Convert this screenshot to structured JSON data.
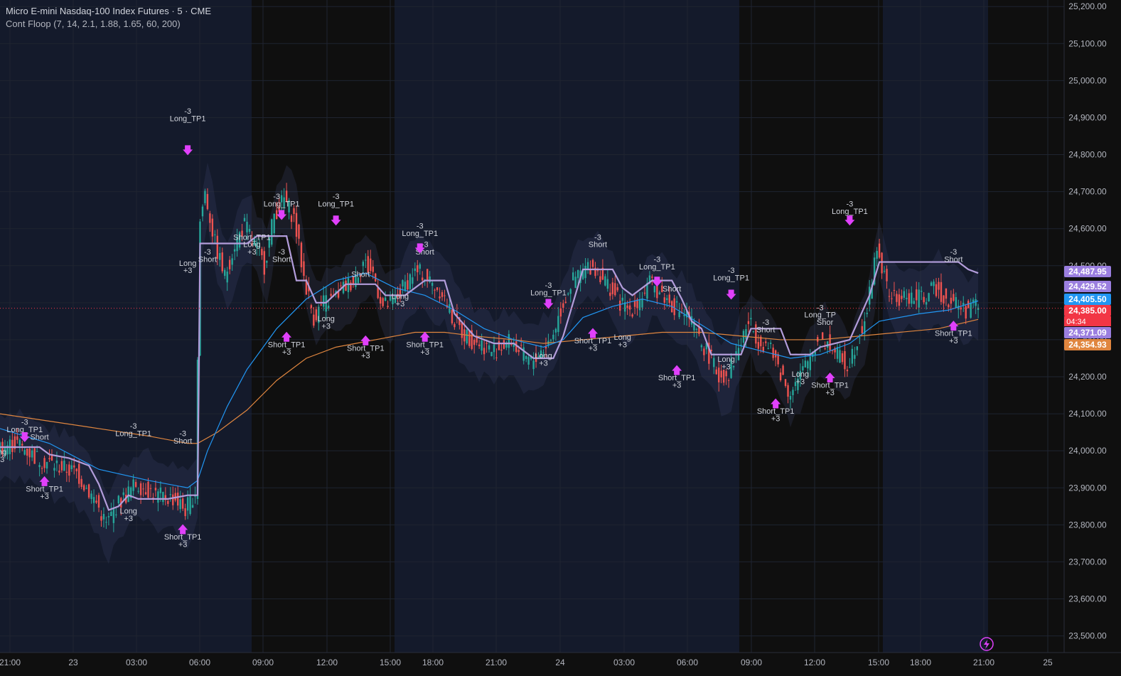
{
  "header": {
    "title": "Micro E-mini Nasdaq-100 Index Futures · 5 · CME",
    "indicator": "Cont Floop (7, 14, 2.1, 1.88, 1.65, 60, 200)"
  },
  "colors": {
    "background": "#0f0f0f",
    "session_bg": "#141a2b",
    "grid": "#1f2430",
    "text": "#d1d4dc",
    "up": "#26a69a",
    "down": "#ef5350",
    "stop_line": "#b39ddb",
    "ema_fast": "#2196f3",
    "ema_slow": "#e0863f",
    "signal_magenta": "#e040fb",
    "signal_red": "#f23645",
    "signal_blue": "#2962ff"
  },
  "chart_data": {
    "type": "candlestick",
    "symbol": "MNQ",
    "timeframe": "5",
    "ylim": [
      23480,
      25210
    ],
    "y_ticks": [
      "25,200.00",
      "25,100.00",
      "25,000.00",
      "24,900.00",
      "24,800.00",
      "24,700.00",
      "24,600.00",
      "24,500.00",
      "24,400.00",
      "24,300.00",
      "24,200.00",
      "24,100.00",
      "24,000.00",
      "23,900.00",
      "23,800.00",
      "23,700.00",
      "23,600.00",
      "23,500.00"
    ],
    "x_ticks": [
      "21:00",
      "23",
      "03:00",
      "06:00",
      "09:00",
      "12:00",
      "15:00",
      "18:00",
      "21:00",
      "24",
      "03:00",
      "06:00",
      "09:00",
      "12:00",
      "15:00",
      "18:00",
      "21:00",
      "25"
    ],
    "last_price": 24385.0,
    "countdown": "04:34",
    "price_labels": [
      {
        "value": "24,487.95",
        "color": "#9b7fe0"
      },
      {
        "value": "24,429.52",
        "color": "#9b7fe0"
      },
      {
        "value": "24,405.50",
        "color": "#2196f3"
      },
      {
        "value": "24,385.00",
        "color": "#f23645"
      },
      {
        "value": "24,371.09",
        "color": "#9b7fe0"
      },
      {
        "value": "24,354.93",
        "color": "#e0863f"
      }
    ],
    "price_path": [
      [
        0,
        24010
      ],
      [
        4,
        24020
      ],
      [
        8,
        23980
      ],
      [
        12,
        23960
      ],
      [
        16,
        23940
      ],
      [
        20,
        23860
      ],
      [
        22,
        23800
      ],
      [
        24,
        23850
      ],
      [
        26,
        23880
      ],
      [
        28,
        23910
      ],
      [
        30,
        23900
      ],
      [
        32,
        23880
      ],
      [
        36,
        23870
      ],
      [
        38,
        23840
      ],
      [
        40,
        23890
      ],
      [
        41,
        24620
      ],
      [
        42,
        24700
      ],
      [
        44,
        24560
      ],
      [
        46,
        24470
      ],
      [
        48,
        24560
      ],
      [
        50,
        24610
      ],
      [
        52,
        24560
      ],
      [
        54,
        24500
      ],
      [
        56,
        24640
      ],
      [
        58,
        24680
      ],
      [
        60,
        24630
      ],
      [
        62,
        24470
      ],
      [
        64,
        24360
      ],
      [
        66,
        24400
      ],
      [
        68,
        24410
      ],
      [
        70,
        24440
      ],
      [
        72,
        24460
      ],
      [
        74,
        24510
      ],
      [
        76,
        24480
      ],
      [
        78,
        24390
      ],
      [
        80,
        24400
      ],
      [
        82,
        24440
      ],
      [
        84,
        24480
      ],
      [
        86,
        24480
      ],
      [
        88,
        24450
      ],
      [
        90,
        24430
      ],
      [
        92,
        24360
      ],
      [
        94,
        24320
      ],
      [
        96,
        24300
      ],
      [
        98,
        24290
      ],
      [
        100,
        24270
      ],
      [
        102,
        24280
      ],
      [
        104,
        24300
      ],
      [
        106,
        24260
      ],
      [
        108,
        24240
      ],
      [
        110,
        24270
      ],
      [
        112,
        24300
      ],
      [
        114,
        24380
      ],
      [
        116,
        24450
      ],
      [
        118,
        24480
      ],
      [
        120,
        24500
      ],
      [
        122,
        24480
      ],
      [
        124,
        24440
      ],
      [
        126,
        24400
      ],
      [
        128,
        24380
      ],
      [
        130,
        24410
      ],
      [
        132,
        24450
      ],
      [
        134,
        24430
      ],
      [
        136,
        24400
      ],
      [
        138,
        24380
      ],
      [
        140,
        24360
      ],
      [
        142,
        24300
      ],
      [
        144,
        24260
      ],
      [
        146,
        24200
      ],
      [
        148,
        24210
      ],
      [
        150,
        24280
      ],
      [
        152,
        24350
      ],
      [
        154,
        24300
      ],
      [
        156,
        24280
      ],
      [
        158,
        24230
      ],
      [
        160,
        24160
      ],
      [
        162,
        24190
      ],
      [
        164,
        24240
      ],
      [
        166,
        24300
      ],
      [
        168,
        24290
      ],
      [
        170,
        24260
      ],
      [
        172,
        24230
      ],
      [
        174,
        24300
      ],
      [
        176,
        24380
      ],
      [
        178,
        24550
      ],
      [
        180,
        24440
      ],
      [
        182,
        24400
      ],
      [
        184,
        24420
      ],
      [
        186,
        24410
      ],
      [
        188,
        24420
      ],
      [
        190,
        24440
      ],
      [
        192,
        24410
      ],
      [
        194,
        24400
      ],
      [
        196,
        24380
      ],
      [
        198,
        24395
      ]
    ],
    "stop_line": [
      [
        0,
        24010
      ],
      [
        8,
        24010
      ],
      [
        10,
        23990
      ],
      [
        14,
        23980
      ],
      [
        18,
        23960
      ],
      [
        20,
        23910
      ],
      [
        22,
        23840
      ],
      [
        24,
        23850
      ],
      [
        26,
        23880
      ],
      [
        28,
        23870
      ],
      [
        34,
        23870
      ],
      [
        38,
        23880
      ],
      [
        40,
        23880
      ],
      [
        40.5,
        24560
      ],
      [
        50,
        24560
      ],
      [
        52,
        24580
      ],
      [
        58,
        24580
      ],
      [
        60,
        24460
      ],
      [
        62,
        24460
      ],
      [
        64,
        24400
      ],
      [
        66,
        24400
      ],
      [
        70,
        24450
      ],
      [
        76,
        24450
      ],
      [
        78,
        24420
      ],
      [
        82,
        24420
      ],
      [
        86,
        24460
      ],
      [
        90,
        24460
      ],
      [
        92,
        24370
      ],
      [
        96,
        24310
      ],
      [
        100,
        24290
      ],
      [
        104,
        24290
      ],
      [
        108,
        24250
      ],
      [
        112,
        24250
      ],
      [
        114,
        24310
      ],
      [
        116,
        24400
      ],
      [
        118,
        24490
      ],
      [
        124,
        24490
      ],
      [
        126,
        24440
      ],
      [
        128,
        24420
      ],
      [
        132,
        24460
      ],
      [
        136,
        24460
      ],
      [
        138,
        24410
      ],
      [
        140,
        24350
      ],
      [
        142,
        24330
      ],
      [
        144,
        24260
      ],
      [
        150,
        24260
      ],
      [
        152,
        24330
      ],
      [
        158,
        24330
      ],
      [
        160,
        24260
      ],
      [
        164,
        24260
      ],
      [
        166,
        24280
      ],
      [
        172,
        24300
      ],
      [
        174,
        24360
      ],
      [
        176,
        24420
      ],
      [
        178,
        24510
      ],
      [
        186,
        24510
      ],
      [
        190,
        24510
      ],
      [
        194,
        24510
      ],
      [
        196,
        24490
      ],
      [
        198,
        24480
      ]
    ],
    "ema_fast": [
      [
        0,
        24060
      ],
      [
        10,
        24020
      ],
      [
        20,
        23950
      ],
      [
        30,
        23920
      ],
      [
        38,
        23900
      ],
      [
        40,
        23920
      ],
      [
        42,
        24000
      ],
      [
        46,
        24120
      ],
      [
        50,
        24220
      ],
      [
        56,
        24330
      ],
      [
        62,
        24410
      ],
      [
        68,
        24460
      ],
      [
        74,
        24480
      ],
      [
        80,
        24440
      ],
      [
        86,
        24420
      ],
      [
        92,
        24380
      ],
      [
        98,
        24330
      ],
      [
        104,
        24300
      ],
      [
        110,
        24280
      ],
      [
        114,
        24300
      ],
      [
        118,
        24360
      ],
      [
        124,
        24390
      ],
      [
        130,
        24410
      ],
      [
        136,
        24390
      ],
      [
        142,
        24340
      ],
      [
        148,
        24290
      ],
      [
        154,
        24270
      ],
      [
        160,
        24250
      ],
      [
        166,
        24260
      ],
      [
        172,
        24290
      ],
      [
        178,
        24350
      ],
      [
        186,
        24370
      ],
      [
        192,
        24380
      ],
      [
        198,
        24405
      ]
    ],
    "ema_slow": [
      [
        0,
        24100
      ],
      [
        10,
        24080
      ],
      [
        20,
        24060
      ],
      [
        30,
        24040
      ],
      [
        38,
        24020
      ],
      [
        40,
        24020
      ],
      [
        44,
        24050
      ],
      [
        50,
        24110
      ],
      [
        56,
        24190
      ],
      [
        62,
        24250
      ],
      [
        68,
        24280
      ],
      [
        76,
        24300
      ],
      [
        84,
        24320
      ],
      [
        90,
        24320
      ],
      [
        96,
        24310
      ],
      [
        104,
        24300
      ],
      [
        110,
        24290
      ],
      [
        118,
        24300
      ],
      [
        126,
        24310
      ],
      [
        134,
        24320
      ],
      [
        142,
        24320
      ],
      [
        150,
        24310
      ],
      [
        158,
        24300
      ],
      [
        166,
        24300
      ],
      [
        174,
        24310
      ],
      [
        182,
        24320
      ],
      [
        190,
        24330
      ],
      [
        198,
        24355
      ]
    ],
    "signals": [
      {
        "label": "-3",
        "type": "top",
        "x": 5,
        "y": 24070
      },
      {
        "label": "Long_TP1",
        "type": "top",
        "x": 5,
        "y": 24050
      },
      {
        "label": "Short",
        "type": "top",
        "x": 8,
        "y": 24030
      },
      {
        "label": "ong",
        "type": "bottom",
        "x": 0,
        "y": 23990
      },
      {
        "label": "+3",
        "type": "bottom",
        "x": 0,
        "y": 23970
      },
      {
        "label": "Short_TP1",
        "type": "bottom",
        "x": 9,
        "y": 23890
      },
      {
        "label": "+3",
        "type": "bottom",
        "x": 9,
        "y": 23870
      },
      {
        "label": "-3",
        "type": "top",
        "x": 27,
        "y": 24060
      },
      {
        "label": "Long_TP1",
        "type": "top",
        "x": 27,
        "y": 24040
      },
      {
        "label": "Long",
        "type": "bottom",
        "x": 26,
        "y": 23830
      },
      {
        "label": "+3",
        "type": "bottom",
        "x": 26,
        "y": 23810
      },
      {
        "label": "-3",
        "type": "top",
        "x": 37,
        "y": 24040
      },
      {
        "label": "Short",
        "type": "top",
        "x": 37,
        "y": 24020
      },
      {
        "label": "Short_TP1",
        "type": "bottom",
        "x": 37,
        "y": 23760
      },
      {
        "label": "+3",
        "type": "bottom",
        "x": 37,
        "y": 23740
      },
      {
        "label": "-3",
        "type": "top",
        "x": 38,
        "y": 24910
      },
      {
        "label": "Long_TP1",
        "type": "top",
        "x": 38,
        "y": 24890
      },
      {
        "label": "Long",
        "type": "bottom",
        "x": 38,
        "y": 24500
      },
      {
        "label": "+3",
        "type": "bottom",
        "x": 38,
        "y": 24480
      },
      {
        "label": "-3",
        "type": "top",
        "x": 42,
        "y": 24530
      },
      {
        "label": "Short",
        "type": "top",
        "x": 42,
        "y": 24510
      },
      {
        "label": "Short_TP1",
        "type": "top",
        "x": 51,
        "y": 24570
      },
      {
        "label": "Long",
        "type": "top",
        "x": 51,
        "y": 24550
      },
      {
        "label": "+3",
        "type": "top",
        "x": 51,
        "y": 24530
      },
      {
        "label": "-3",
        "type": "top",
        "x": 56,
        "y": 24680
      },
      {
        "label": "Long_TP1",
        "type": "top",
        "x": 57,
        "y": 24660
      },
      {
        "label": "-3",
        "type": "top",
        "x": 57,
        "y": 24530
      },
      {
        "label": "Short",
        "type": "top",
        "x": 57,
        "y": 24510
      },
      {
        "label": "Short_TP1",
        "type": "bottom",
        "x": 58,
        "y": 24280
      },
      {
        "label": "+3",
        "type": "bottom",
        "x": 58,
        "y": 24260
      },
      {
        "label": "-3",
        "type": "top",
        "x": 68,
        "y": 24680
      },
      {
        "label": "Long_TP1",
        "type": "top",
        "x": 68,
        "y": 24660
      },
      {
        "label": "Short",
        "type": "top",
        "x": 73,
        "y": 24470
      },
      {
        "label": "Long",
        "type": "bottom",
        "x": 66,
        "y": 24350
      },
      {
        "label": "+3",
        "type": "bottom",
        "x": 66,
        "y": 24330
      },
      {
        "label": "Short_TP1",
        "type": "bottom",
        "x": 74,
        "y": 24270
      },
      {
        "label": "+3",
        "type": "bottom",
        "x": 74,
        "y": 24250
      },
      {
        "label": "-3",
        "type": "top",
        "x": 85,
        "y": 24600
      },
      {
        "label": "Long_TP1",
        "type": "top",
        "x": 85,
        "y": 24580
      },
      {
        "label": "-3",
        "type": "top",
        "x": 86,
        "y": 24550
      },
      {
        "label": "Short",
        "type": "top",
        "x": 86,
        "y": 24530
      },
      {
        "label": "Long",
        "type": "bottom",
        "x": 81,
        "y": 24410
      },
      {
        "label": "+3",
        "type": "bottom",
        "x": 81,
        "y": 24390
      },
      {
        "label": "Short_TP1",
        "type": "bottom",
        "x": 86,
        "y": 24280
      },
      {
        "label": "+3",
        "type": "bottom",
        "x": 86,
        "y": 24260
      },
      {
        "label": "-3",
        "type": "top",
        "x": 111,
        "y": 24440
      },
      {
        "label": "Long_TP1",
        "type": "top",
        "x": 111,
        "y": 24420
      },
      {
        "label": "Long",
        "type": "bottom",
        "x": 110,
        "y": 24250
      },
      {
        "label": "+3",
        "type": "bottom",
        "x": 110,
        "y": 24230
      },
      {
        "label": "-3",
        "type": "top",
        "x": 121,
        "y": 24570
      },
      {
        "label": "Short",
        "type": "top",
        "x": 121,
        "y": 24550
      },
      {
        "label": "Short_TP1",
        "type": "bottom",
        "x": 120,
        "y": 24290
      },
      {
        "label": "+3",
        "type": "bottom",
        "x": 120,
        "y": 24270
      },
      {
        "label": "Long",
        "type": "bottom",
        "x": 126,
        "y": 24300
      },
      {
        "label": "+3",
        "type": "bottom",
        "x": 126,
        "y": 24280
      },
      {
        "label": "-3",
        "type": "top",
        "x": 133,
        "y": 24510
      },
      {
        "label": "Long_TP1",
        "type": "top",
        "x": 133,
        "y": 24490
      },
      {
        "label": "Short",
        "type": "top",
        "x": 136,
        "y": 24430
      },
      {
        "label": "Short_TP1",
        "type": "bottom",
        "x": 137,
        "y": 24190
      },
      {
        "label": "+3",
        "type": "bottom",
        "x": 137,
        "y": 24170
      },
      {
        "label": "-3",
        "type": "top",
        "x": 148,
        "y": 24480
      },
      {
        "label": "Long_TP1",
        "type": "top",
        "x": 148,
        "y": 24460
      },
      {
        "label": "Long",
        "type": "bottom",
        "x": 147,
        "y": 24240
      },
      {
        "label": "+3",
        "type": "bottom",
        "x": 147,
        "y": 24220
      },
      {
        "label": "-3",
        "type": "top",
        "x": 155,
        "y": 24340
      },
      {
        "label": "Short",
        "type": "top",
        "x": 155,
        "y": 24320
      },
      {
        "label": "Short_TP1",
        "type": "bottom",
        "x": 157,
        "y": 24100
      },
      {
        "label": "+3",
        "type": "bottom",
        "x": 157,
        "y": 24080
      },
      {
        "label": "Long",
        "type": "bottom",
        "x": 162,
        "y": 24200
      },
      {
        "label": "+3",
        "type": "bottom",
        "x": 162,
        "y": 24180
      },
      {
        "label": "-3",
        "type": "top",
        "x": 166,
        "y": 24380
      },
      {
        "label": "Long_TP",
        "type": "top",
        "x": 166,
        "y": 24360
      },
      {
        "label": "Shor",
        "type": "top",
        "x": 167,
        "y": 24340
      },
      {
        "label": "Short_TP1",
        "type": "bottom",
        "x": 168,
        "y": 24170
      },
      {
        "label": "+3",
        "type": "bottom",
        "x": 168,
        "y": 24150
      },
      {
        "label": "-3",
        "type": "top",
        "x": 172,
        "y": 24660
      },
      {
        "label": "Long_TP1",
        "type": "top",
        "x": 172,
        "y": 24640
      },
      {
        "label": "-3",
        "type": "top",
        "x": 193,
        "y": 24530
      },
      {
        "label": "Short",
        "type": "top",
        "x": 193,
        "y": 24510
      },
      {
        "label": "Short_TP1",
        "type": "bottom",
        "x": 193,
        "y": 24310
      },
      {
        "label": "+3",
        "type": "bottom",
        "x": 193,
        "y": 24290
      }
    ]
  }
}
